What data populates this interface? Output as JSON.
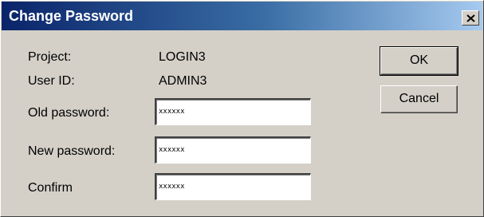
{
  "window": {
    "title": "Change Password"
  },
  "info": {
    "project_label": "Project:",
    "project_value": "LOGIN3",
    "userid_label": "User ID:",
    "userid_value": "ADMIN3"
  },
  "fields": {
    "old_label": "Old password:",
    "old_value": "xxxxxx",
    "new_label": "New password:",
    "new_value": "xxxxxx",
    "confirm_label": "Confirm",
    "confirm_value": "xxxxxx"
  },
  "buttons": {
    "ok_label": "OK",
    "cancel_label": "Cancel"
  },
  "icons": {
    "close": "close-icon"
  }
}
